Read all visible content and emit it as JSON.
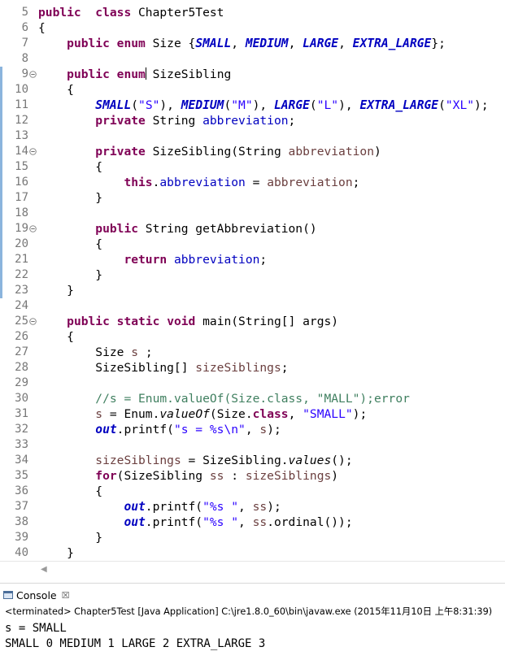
{
  "editor": {
    "lines": [
      {
        "num": "5",
        "fold": false,
        "mark": false,
        "segs": [
          [
            "kw",
            "public"
          ],
          [
            "",
            "  "
          ],
          [
            "kw",
            "class"
          ],
          [
            "",
            " Chapter5Test"
          ]
        ]
      },
      {
        "num": "6",
        "fold": false,
        "mark": false,
        "segs": [
          [
            "",
            "{"
          ]
        ]
      },
      {
        "num": "7",
        "fold": false,
        "mark": false,
        "segs": [
          [
            "",
            "    "
          ],
          [
            "kw",
            "public"
          ],
          [
            "",
            " "
          ],
          [
            "kw",
            "enum"
          ],
          [
            "",
            " Size {"
          ],
          [
            "fld-it",
            "SMALL"
          ],
          [
            "",
            ", "
          ],
          [
            "fld-it",
            "MEDIUM"
          ],
          [
            "",
            ", "
          ],
          [
            "fld-it",
            "LARGE"
          ],
          [
            "",
            ", "
          ],
          [
            "fld-it",
            "EXTRA_LARGE"
          ],
          [
            "",
            "};"
          ]
        ]
      },
      {
        "num": "8",
        "fold": false,
        "mark": false,
        "segs": []
      },
      {
        "num": "9",
        "fold": true,
        "mark": true,
        "segs": [
          [
            "",
            "    "
          ],
          [
            "kw",
            "public"
          ],
          [
            "",
            " "
          ],
          [
            "kw",
            "enum"
          ],
          [
            "cursor",
            ""
          ],
          [
            "",
            " SizeSibling"
          ]
        ]
      },
      {
        "num": "10",
        "fold": false,
        "mark": true,
        "segs": [
          [
            "",
            "    {"
          ]
        ]
      },
      {
        "num": "11",
        "fold": false,
        "mark": true,
        "segs": [
          [
            "",
            "        "
          ],
          [
            "fld-it",
            "SMALL"
          ],
          [
            "",
            "("
          ],
          [
            "str",
            "\"S\""
          ],
          [
            "",
            "), "
          ],
          [
            "fld-it",
            "MEDIUM"
          ],
          [
            "",
            "("
          ],
          [
            "str",
            "\"M\""
          ],
          [
            "",
            "), "
          ],
          [
            "fld-it",
            "LARGE"
          ],
          [
            "",
            "("
          ],
          [
            "str",
            "\"L\""
          ],
          [
            "",
            "), "
          ],
          [
            "fld-it",
            "EXTRA_LARGE"
          ],
          [
            "",
            "("
          ],
          [
            "str",
            "\"XL\""
          ],
          [
            "",
            ");"
          ]
        ]
      },
      {
        "num": "12",
        "fold": false,
        "mark": true,
        "segs": [
          [
            "",
            "        "
          ],
          [
            "kw",
            "private"
          ],
          [
            "",
            " String "
          ],
          [
            "fld",
            "abbreviation"
          ],
          [
            "",
            ";"
          ]
        ]
      },
      {
        "num": "13",
        "fold": false,
        "mark": true,
        "segs": []
      },
      {
        "num": "14",
        "fold": true,
        "mark": true,
        "segs": [
          [
            "",
            "        "
          ],
          [
            "kw",
            "private"
          ],
          [
            "",
            " SizeSibling(String "
          ],
          [
            "var",
            "abbreviation"
          ],
          [
            "",
            ")"
          ]
        ]
      },
      {
        "num": "15",
        "fold": false,
        "mark": true,
        "segs": [
          [
            "",
            "        {"
          ]
        ]
      },
      {
        "num": "16",
        "fold": false,
        "mark": true,
        "segs": [
          [
            "",
            "            "
          ],
          [
            "kw",
            "this"
          ],
          [
            "",
            "."
          ],
          [
            "fld",
            "abbreviation"
          ],
          [
            "",
            " = "
          ],
          [
            "var",
            "abbreviation"
          ],
          [
            "",
            ";"
          ]
        ]
      },
      {
        "num": "17",
        "fold": false,
        "mark": true,
        "segs": [
          [
            "",
            "        }"
          ]
        ]
      },
      {
        "num": "18",
        "fold": false,
        "mark": true,
        "segs": []
      },
      {
        "num": "19",
        "fold": true,
        "mark": true,
        "segs": [
          [
            "",
            "        "
          ],
          [
            "kw",
            "public"
          ],
          [
            "",
            " String getAbbreviation()"
          ]
        ]
      },
      {
        "num": "20",
        "fold": false,
        "mark": true,
        "segs": [
          [
            "",
            "        {"
          ]
        ]
      },
      {
        "num": "21",
        "fold": false,
        "mark": true,
        "segs": [
          [
            "",
            "            "
          ],
          [
            "kw",
            "return"
          ],
          [
            "",
            " "
          ],
          [
            "fld",
            "abbreviation"
          ],
          [
            "",
            ";"
          ]
        ]
      },
      {
        "num": "22",
        "fold": false,
        "mark": true,
        "segs": [
          [
            "",
            "        }"
          ]
        ]
      },
      {
        "num": "23",
        "fold": false,
        "mark": true,
        "segs": [
          [
            "",
            "    }"
          ]
        ]
      },
      {
        "num": "24",
        "fold": false,
        "mark": false,
        "segs": []
      },
      {
        "num": "25",
        "fold": true,
        "mark": false,
        "segs": [
          [
            "",
            "    "
          ],
          [
            "kw",
            "public"
          ],
          [
            "",
            " "
          ],
          [
            "kw",
            "static"
          ],
          [
            "",
            " "
          ],
          [
            "kw",
            "void"
          ],
          [
            "",
            " main(String[] args)"
          ]
        ]
      },
      {
        "num": "26",
        "fold": false,
        "mark": false,
        "segs": [
          [
            "",
            "    {"
          ]
        ]
      },
      {
        "num": "27",
        "fold": false,
        "mark": false,
        "segs": [
          [
            "",
            "        Size "
          ],
          [
            "var",
            "s"
          ],
          [
            "",
            " ;"
          ]
        ]
      },
      {
        "num": "28",
        "fold": false,
        "mark": false,
        "segs": [
          [
            "",
            "        SizeSibling[] "
          ],
          [
            "var",
            "sizeSiblings"
          ],
          [
            "",
            ";"
          ]
        ]
      },
      {
        "num": "29",
        "fold": false,
        "mark": false,
        "segs": []
      },
      {
        "num": "30",
        "fold": false,
        "mark": false,
        "segs": [
          [
            "",
            "        "
          ],
          [
            "cmt",
            "//s = Enum.valueOf(Size.class, \"MALL\");error"
          ]
        ]
      },
      {
        "num": "31",
        "fold": false,
        "mark": false,
        "segs": [
          [
            "",
            "        "
          ],
          [
            "var",
            "s"
          ],
          [
            "",
            " = Enum."
          ],
          [
            "mth-it",
            "valueOf"
          ],
          [
            "",
            "(Size."
          ],
          [
            "kw",
            "class"
          ],
          [
            "",
            ", "
          ],
          [
            "str",
            "\"SMALL\""
          ],
          [
            "",
            ");"
          ]
        ]
      },
      {
        "num": "32",
        "fold": false,
        "mark": false,
        "segs": [
          [
            "",
            "        "
          ],
          [
            "fld-st",
            "out"
          ],
          [
            "",
            ".printf("
          ],
          [
            "str",
            "\"s = %s\\n\""
          ],
          [
            "",
            ", "
          ],
          [
            "var",
            "s"
          ],
          [
            "",
            ");"
          ]
        ]
      },
      {
        "num": "33",
        "fold": false,
        "mark": false,
        "segs": []
      },
      {
        "num": "34",
        "fold": false,
        "mark": false,
        "segs": [
          [
            "",
            "        "
          ],
          [
            "var",
            "sizeSiblings"
          ],
          [
            "",
            " = SizeSibling."
          ],
          [
            "mth-it",
            "values"
          ],
          [
            "",
            "();"
          ]
        ]
      },
      {
        "num": "35",
        "fold": false,
        "mark": false,
        "segs": [
          [
            "",
            "        "
          ],
          [
            "kw",
            "for"
          ],
          [
            "",
            "(SizeSibling "
          ],
          [
            "var",
            "ss"
          ],
          [
            "",
            " : "
          ],
          [
            "var",
            "sizeSiblings"
          ],
          [
            "",
            ")"
          ]
        ]
      },
      {
        "num": "36",
        "fold": false,
        "mark": false,
        "segs": [
          [
            "",
            "        {"
          ]
        ]
      },
      {
        "num": "37",
        "fold": false,
        "mark": false,
        "segs": [
          [
            "",
            "            "
          ],
          [
            "fld-st",
            "out"
          ],
          [
            "",
            ".printf("
          ],
          [
            "str",
            "\"%s \""
          ],
          [
            "",
            ", "
          ],
          [
            "var",
            "ss"
          ],
          [
            "",
            ");"
          ]
        ]
      },
      {
        "num": "38",
        "fold": false,
        "mark": false,
        "segs": [
          [
            "",
            "            "
          ],
          [
            "fld-st",
            "out"
          ],
          [
            "",
            ".printf("
          ],
          [
            "str",
            "\"%s \""
          ],
          [
            "",
            ", "
          ],
          [
            "var",
            "ss"
          ],
          [
            "",
            ".ordinal());"
          ]
        ]
      },
      {
        "num": "39",
        "fold": false,
        "mark": false,
        "segs": [
          [
            "",
            "        }"
          ]
        ]
      },
      {
        "num": "40",
        "fold": false,
        "mark": false,
        "segs": [
          [
            "",
            "    }"
          ]
        ]
      }
    ]
  },
  "console": {
    "tab_label": "Console",
    "close_glyph": "☒",
    "status": "<terminated> Chapter5Test [Java Application] C:\\jre1.8.0_60\\bin\\javaw.exe (2015年11月10日 上午8:31:39)",
    "output": [
      "s = SMALL",
      "SMALL 0 MEDIUM 1 LARGE 2 EXTRA_LARGE 3"
    ]
  },
  "scroll": {
    "left_arrow": "◀"
  },
  "colors": {
    "keyword": "#7f0055",
    "string": "#2a00ff",
    "field": "#0000c0",
    "local": "#6a3e3e",
    "comment": "#3f7f5f",
    "marker": "#8bb4dd"
  }
}
